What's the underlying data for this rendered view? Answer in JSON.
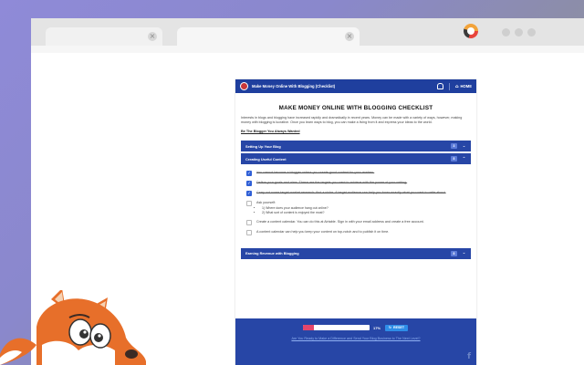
{
  "browser": {
    "tab_close_glyph": "×",
    "extension_icon": "colorful-ring-icon"
  },
  "header": {
    "title": "Make Money Online With Blogging (Checklist)",
    "home_label": "HOME",
    "home_icon": "⌂"
  },
  "main": {
    "title": "MAKE MONEY ONLINE WITH BLOGGING CHECKLIST",
    "intro": "Interests in blogs and blogging have increased rapidly and dramatically in recent years. Money can be made with a variety of ways, however, making money with blogging is lucrative. Once you learn ways to blog, you can make a living from it and express your ideas to the world.",
    "intro_link": "Be The Blogger You Always Wanted"
  },
  "sections": [
    {
      "label": "Setting Up Your Blog",
      "count": "3",
      "chevron": "⌄"
    },
    {
      "label": "Creating Useful Content",
      "count": "8",
      "chevron": "⌃"
    },
    {
      "label": "Earning Revenue with Blogging",
      "count": "8",
      "chevron": "⌄"
    }
  ],
  "checklist": [
    {
      "text": "You cannot become a blogger unless you create good content for your readers.",
      "checked": true
    },
    {
      "text": "Define your goals and aims. These are the targets you want to achieve with the power of your writing.",
      "checked": true
    },
    {
      "text": "Carry out some target market research: find a niche. A target audience can help you know exactly what you want to write about.",
      "checked": true
    },
    {
      "text": "Ask yourself:",
      "checked": false,
      "sub": [
        "1) Where does your audience hang out online?",
        "2) What sort of content is enjoyed the most?"
      ]
    },
    {
      "text": "Create a content calendar. You can do this at Airtable. Sign in with your email address and create a free account.",
      "checked": false
    },
    {
      "text": "A content calendar can help you keep your content on top-notch and to publish it on time.",
      "checked": false
    }
  ],
  "progress": {
    "percent_value": 17,
    "percent_label": "17%",
    "reset_label": "RESET",
    "reset_icon": "↻"
  },
  "footer": {
    "link": "Are You Ready to Make a Difference and Send Your Blog Business to The Next Level?",
    "facebook_icon": "f"
  },
  "colors": {
    "header_blue": "#1f3f9e",
    "section_blue": "#2746a6",
    "check_blue": "#2f5fd6",
    "progress_pink": "#e4466b",
    "reset_blue": "#2e8de8"
  }
}
